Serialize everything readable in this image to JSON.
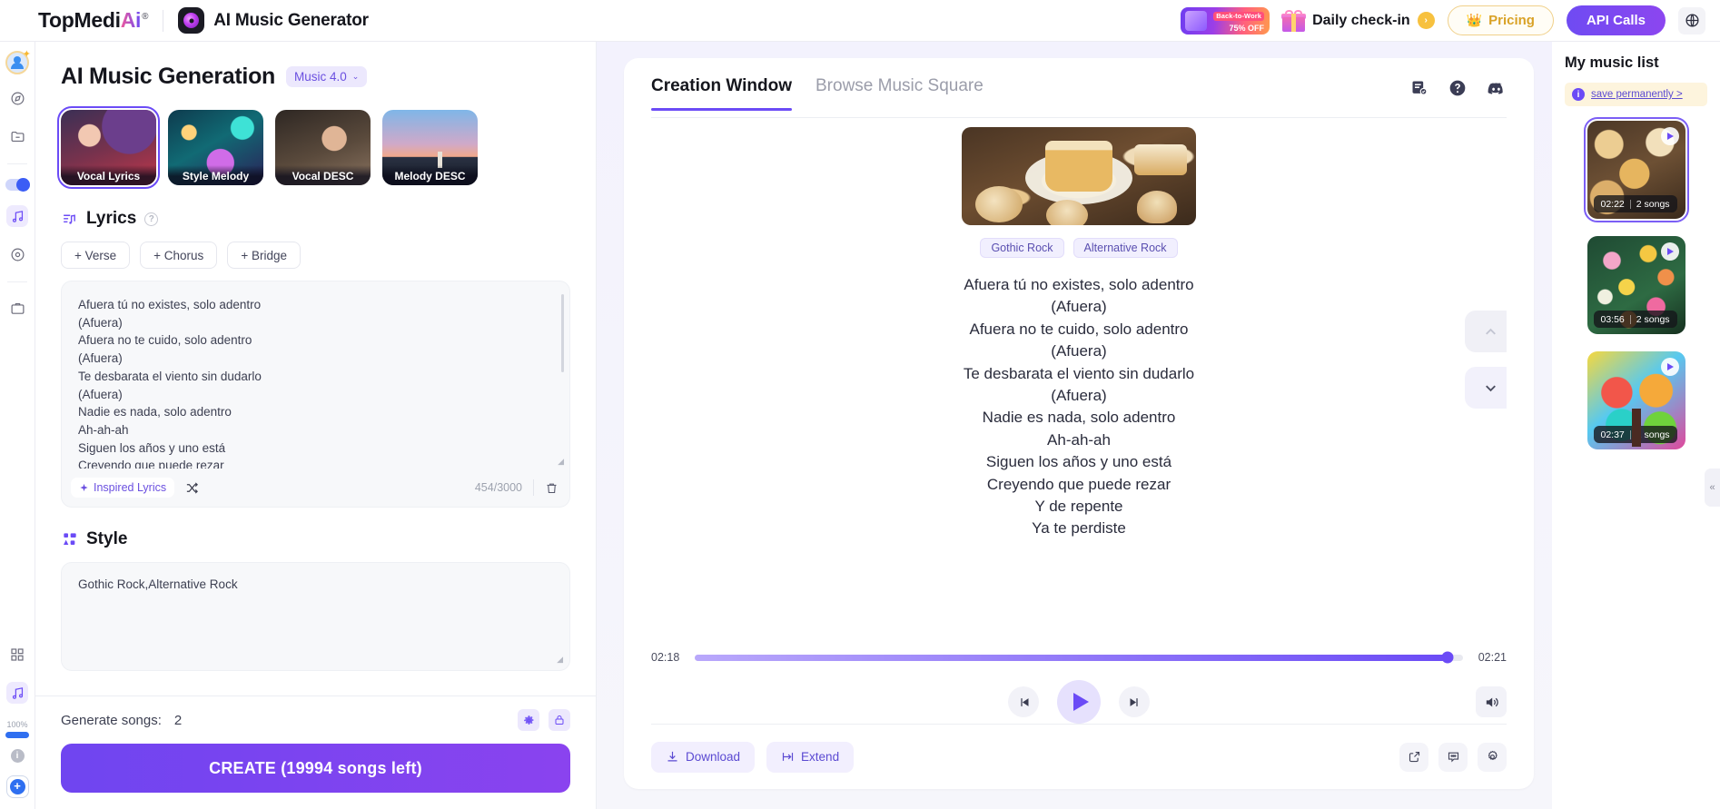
{
  "header": {
    "brand_main": "TopMedi",
    "brand_accent": "Ai",
    "brand_reg": "®",
    "app_title": "AI Music Generator",
    "promo_line1": "Back-to-Work",
    "promo_line2": "75% OFF",
    "checkin_label": "Daily check-in",
    "checkin_chevron": "›",
    "pricing_label": "Pricing",
    "pricing_icon": "crown-icon",
    "api_label": "API Calls",
    "language_icon": "globe-icon"
  },
  "rail": {
    "items": [
      {
        "name": "user-avatar",
        "label": "avatar"
      },
      {
        "name": "explore-icon",
        "label": "explore"
      },
      {
        "name": "folder-icon",
        "label": "folder"
      },
      {
        "name": "toggle-switch",
        "label": "toggle"
      },
      {
        "name": "music-note-icon",
        "label": "music"
      },
      {
        "name": "disc-icon",
        "label": "disc"
      },
      {
        "name": "briefcase-icon",
        "label": "workspace"
      },
      {
        "name": "grid-icon",
        "label": "apps"
      },
      {
        "name": "music-note-icon-2",
        "label": "music-2"
      }
    ],
    "percent_label": "100%",
    "info_label": "i",
    "plus_label": "+"
  },
  "left_panel": {
    "title": "AI Music Generation",
    "model": "Music 4.0",
    "model_chevron": "⌄",
    "modes": [
      {
        "label": "Vocal Lyrics",
        "selected": true
      },
      {
        "label": "Style Melody",
        "selected": false
      },
      {
        "label": "Vocal DESC",
        "selected": false
      },
      {
        "label": "Melody DESC",
        "selected": false
      }
    ],
    "lyrics_section": {
      "title": "Lyrics",
      "help": "?",
      "buttons": [
        "+ Verse",
        "+ Chorus",
        "+ Bridge"
      ],
      "value": "Afuera tú no existes, solo adentro\n(Afuera)\nAfuera no te cuido, solo adentro\n(Afuera)\nTe desbarata el viento sin dudarlo\n(Afuera)\nNadie es nada, solo adentro\nAh-ah-ah\nSiguen los años y uno está\nCreyendo que puede rezar",
      "inspired_label": "Inspired Lyrics",
      "shuffle_icon": "shuffle-icon",
      "counter": "454/3000",
      "delete_icon": "trash-icon"
    },
    "style_section": {
      "title": "Style",
      "value": "Gothic Rock,Alternative Rock"
    },
    "footer": {
      "generate_label": "Generate songs:",
      "generate_value": "2",
      "settings_icon": "gear-icon",
      "lock_icon": "lock-icon",
      "create_label": "CREATE (19994 songs left)"
    }
  },
  "center": {
    "tabs": [
      {
        "label": "Creation Window",
        "active": true
      },
      {
        "label": "Browse Music Square",
        "active": false
      }
    ],
    "tab_icons": [
      "task-list-icon",
      "help-circle-icon",
      "discord-icon"
    ],
    "cover_alt": "golden cake album art",
    "tags": [
      "Gothic Rock",
      "Alternative Rock"
    ],
    "lyrics": "Afuera tú no existes, solo adentro\n(Afuera)\nAfuera no te cuido, solo adentro\n(Afuera)\nTe desbarata el viento sin dudarlo\n(Afuera)\nNadie es nada, solo adentro\nAh-ah-ah\nSiguen los años y uno está\nCreyendo que puede rezar\nY de repente\nYa te perdiste",
    "nav_up_icon": "chevron-up-icon",
    "nav_down_icon": "chevron-down-icon",
    "player": {
      "current_time": "02:18",
      "total_time": "02:21",
      "progress_percent": 98,
      "prev_icon": "skip-previous-icon",
      "play_icon": "play-icon",
      "next_icon": "skip-next-icon",
      "volume_icon": "volume-icon"
    },
    "actions": {
      "download_label": "Download",
      "extend_label": "Extend",
      "share_icon": "external-link-icon",
      "comment_icon": "comment-icon",
      "settings_icon": "gear-icon"
    }
  },
  "collapse_handle": "«",
  "right_panel": {
    "title": "My music list",
    "save_badge_icon": "info-icon",
    "save_label": "save permanently >",
    "cards": [
      {
        "duration": "02:22",
        "songs": "2 songs",
        "art": "cake",
        "selected": true
      },
      {
        "duration": "03:56",
        "songs": "2 songs",
        "art": "flower",
        "selected": false
      },
      {
        "duration": "02:37",
        "songs": "2 songs",
        "art": "tree",
        "selected": false
      }
    ]
  },
  "colors": {
    "accent": "#6b4bf6",
    "accent_grad_end": "#8a43ef",
    "pricing": "#d9a227",
    "bg_center": "#f3f2fd"
  }
}
